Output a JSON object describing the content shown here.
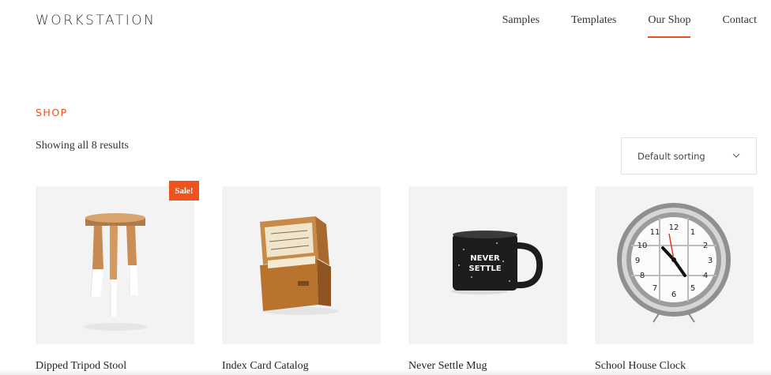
{
  "header": {
    "logo": "WORKSTATION",
    "nav": [
      {
        "label": "Samples"
      },
      {
        "label": "Templates"
      },
      {
        "label": "Our Shop"
      },
      {
        "label": "Contact"
      }
    ],
    "active_nav": "Our Shop"
  },
  "shop": {
    "title": "SHOP",
    "result_count": "Showing all 8 results",
    "sort": {
      "selected": "Default sorting",
      "icon": "chevron-down-icon"
    },
    "sale_badge": "Sale!",
    "products": [
      {
        "name": "Dipped Tripod Stool",
        "image": "stool-image",
        "on_sale": true
      },
      {
        "name": "Index Card Catalog",
        "image": "card-catalog-image",
        "on_sale": false
      },
      {
        "name": "Never Settle Mug",
        "image": "mug-image",
        "on_sale": false,
        "mug_text": [
          "NEVER",
          "SETTLE"
        ]
      },
      {
        "name": "School House Clock",
        "image": "clock-image",
        "on_sale": false
      }
    ]
  },
  "colors": {
    "accent": "#e8511f",
    "thumb_bg": "#f3f3f3",
    "text": "#333333"
  }
}
